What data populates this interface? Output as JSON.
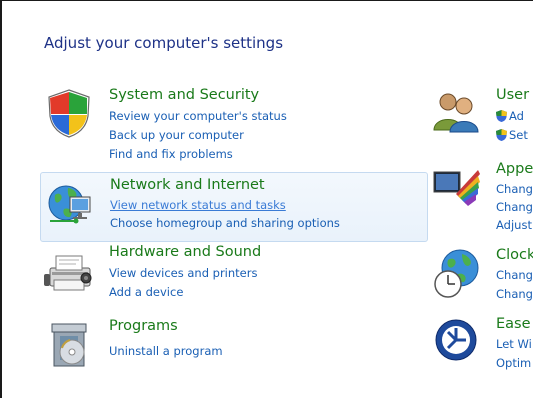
{
  "page_title": "Adjust your computer's settings",
  "categories": [
    {
      "title": "System and Security",
      "icon": "shield-icon",
      "links": [
        "Review your computer's status",
        "Back up your computer",
        "Find and fix problems"
      ]
    },
    {
      "title": "Network and Internet",
      "icon": "network-globe-icon",
      "links": [
        "View network status and tasks",
        "Choose homegroup and sharing options"
      ]
    },
    {
      "title": "Hardware and Sound",
      "icon": "printer-icon",
      "links": [
        "View devices and printers",
        "Add a device"
      ]
    },
    {
      "title": "Programs",
      "icon": "programs-box-icon",
      "links": [
        "Uninstall a program"
      ]
    }
  ],
  "right_categories": [
    {
      "title": "User",
      "icon": "users-icon",
      "links": [
        "Ad",
        "Set"
      ]
    },
    {
      "title": "Appe",
      "icon": "appearance-monitor-icon",
      "links": [
        "Chang",
        "Chang",
        "Adjust"
      ]
    },
    {
      "title": "Clock",
      "icon": "clock-globe-icon",
      "links": [
        "Chang",
        "Chang"
      ]
    },
    {
      "title": "Ease",
      "icon": "ease-of-access-icon",
      "links": [
        "Let Wi",
        "Optim"
      ]
    }
  ],
  "colors": {
    "title_blue": "#1e3287",
    "category_green": "#1a7a1a",
    "link_blue": "#1a5fb4",
    "highlight_border": "#c5daf0"
  }
}
